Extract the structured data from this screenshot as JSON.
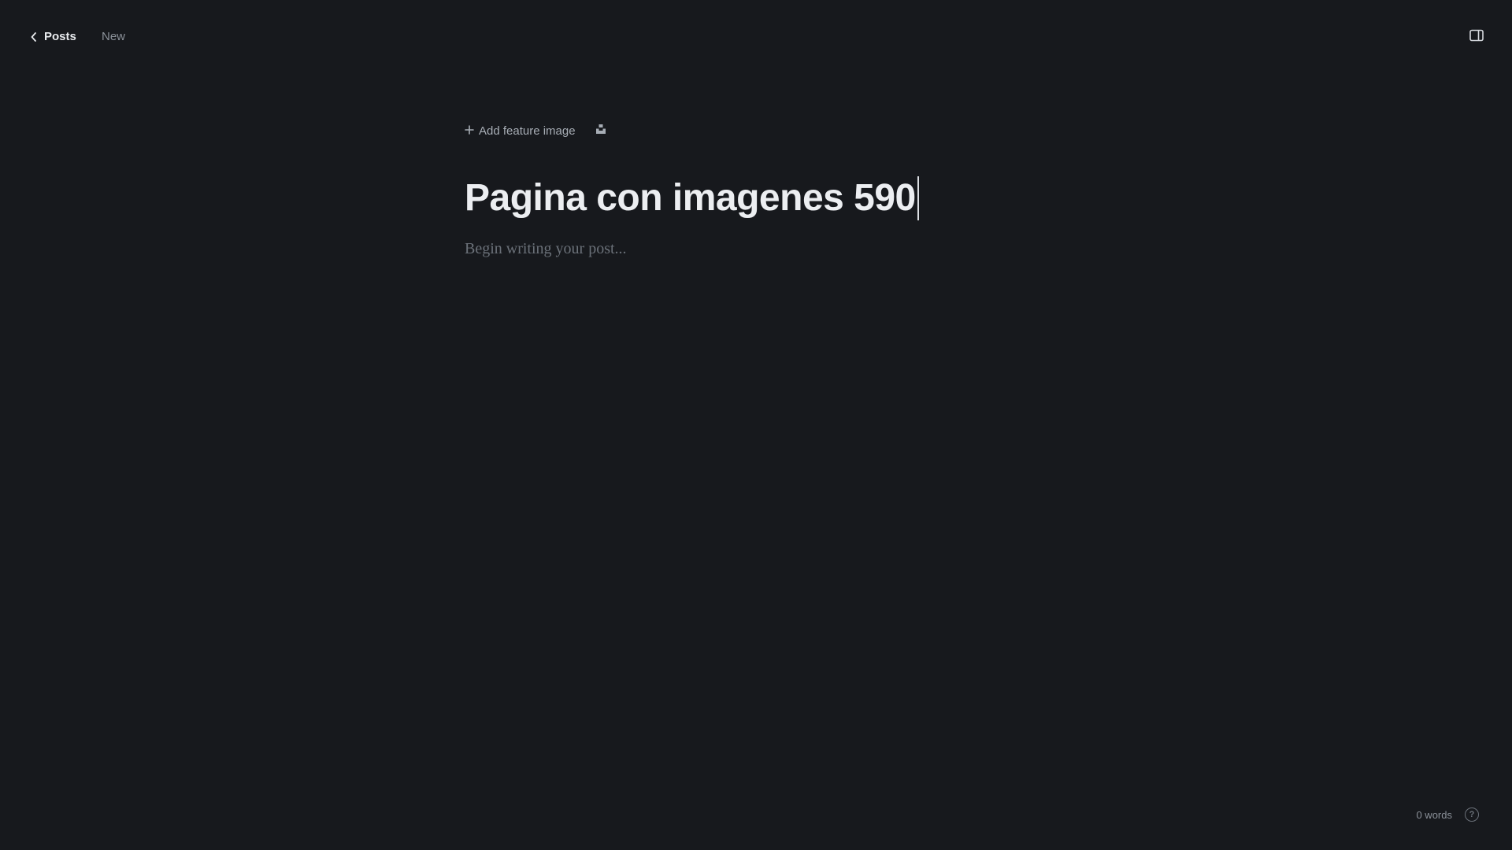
{
  "header": {
    "breadcrumb_parent": "Posts",
    "breadcrumb_status": "New",
    "back_icon": "chevron-left-icon",
    "sidebar_toggle_icon": "sidebar-panel-icon"
  },
  "editor": {
    "add_feature_image_label": "Add feature image",
    "add_feature_icon": "plus-icon",
    "unsplash_icon": "unsplash-icon",
    "title": "Pagina con imagenes 590",
    "body_placeholder": "Begin writing your post..."
  },
  "footer": {
    "word_count": "0 words",
    "help_label": "?",
    "help_icon": "help-circle-icon"
  },
  "colors": {
    "background": "#17191d",
    "title": "#eceef1",
    "muted": "#8b9199",
    "placeholder": "#6b7179"
  }
}
